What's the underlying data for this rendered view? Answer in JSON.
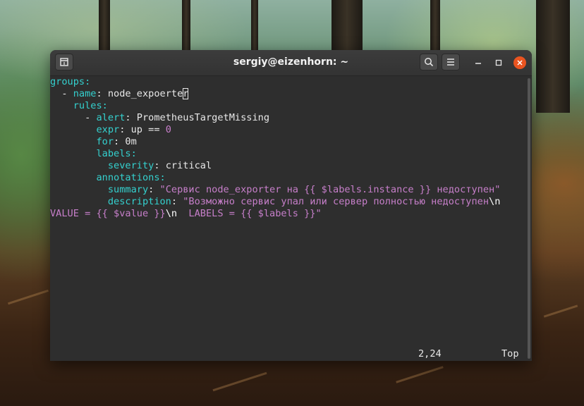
{
  "window": {
    "title": "sergiy@eizenhorn: ~"
  },
  "icons": {
    "new_tab": "new-tab-icon",
    "search": "search-icon",
    "menu": "hamburger-menu-icon",
    "minimize": "minimize-icon",
    "maximize": "maximize-icon",
    "close": "close-icon"
  },
  "colors": {
    "yaml_key": "#34d1cf",
    "string_number": "#c77fca",
    "close_button": "#e95420",
    "terminal_bg": "#2e2e2e"
  },
  "editor": {
    "lines": {
      "l1": {
        "key": "groups",
        "colon": ":"
      },
      "l2": {
        "indent": "  - ",
        "key": "name",
        "colon": ": ",
        "value_before_cursor": "node_expoerte",
        "cursor_char": "r"
      },
      "l3": {
        "indent": "    ",
        "key": "rules",
        "colon": ":"
      },
      "l4": {
        "indent": "      - ",
        "key": "alert",
        "colon": ": ",
        "value": "PrometheusTargetMissing"
      },
      "l5": {
        "indent": "        ",
        "key": "expr",
        "colon": ": ",
        "value": "up == ",
        "number": "0"
      },
      "l6": {
        "indent": "        ",
        "key": "for",
        "colon": ": ",
        "value": "0m"
      },
      "l7": {
        "indent": "        ",
        "key": "labels",
        "colon": ":"
      },
      "l8": {
        "indent": "          ",
        "key": "severity",
        "colon": ": ",
        "value": "critical"
      },
      "l9": {
        "indent": "        ",
        "key": "annotations",
        "colon": ":"
      },
      "l10": {
        "indent": "          ",
        "key": "summary",
        "colon": ": ",
        "string": "\"Сервис node_exporter на {{ $labels.instance }} недоступен\""
      },
      "l11": {
        "indent": "          ",
        "key": "description",
        "colon": ": ",
        "string": "\"Возможно сервис упал или сервер полностью недоступен",
        "escape": "\\n"
      },
      "l12": {
        "string_a": "VALUE = {{ $value }}",
        "escape": "\\n",
        "string_b": "  LABELS = {{ $labels }}\""
      }
    }
  },
  "statusline": {
    "position": "2,24",
    "scroll": "Top"
  }
}
